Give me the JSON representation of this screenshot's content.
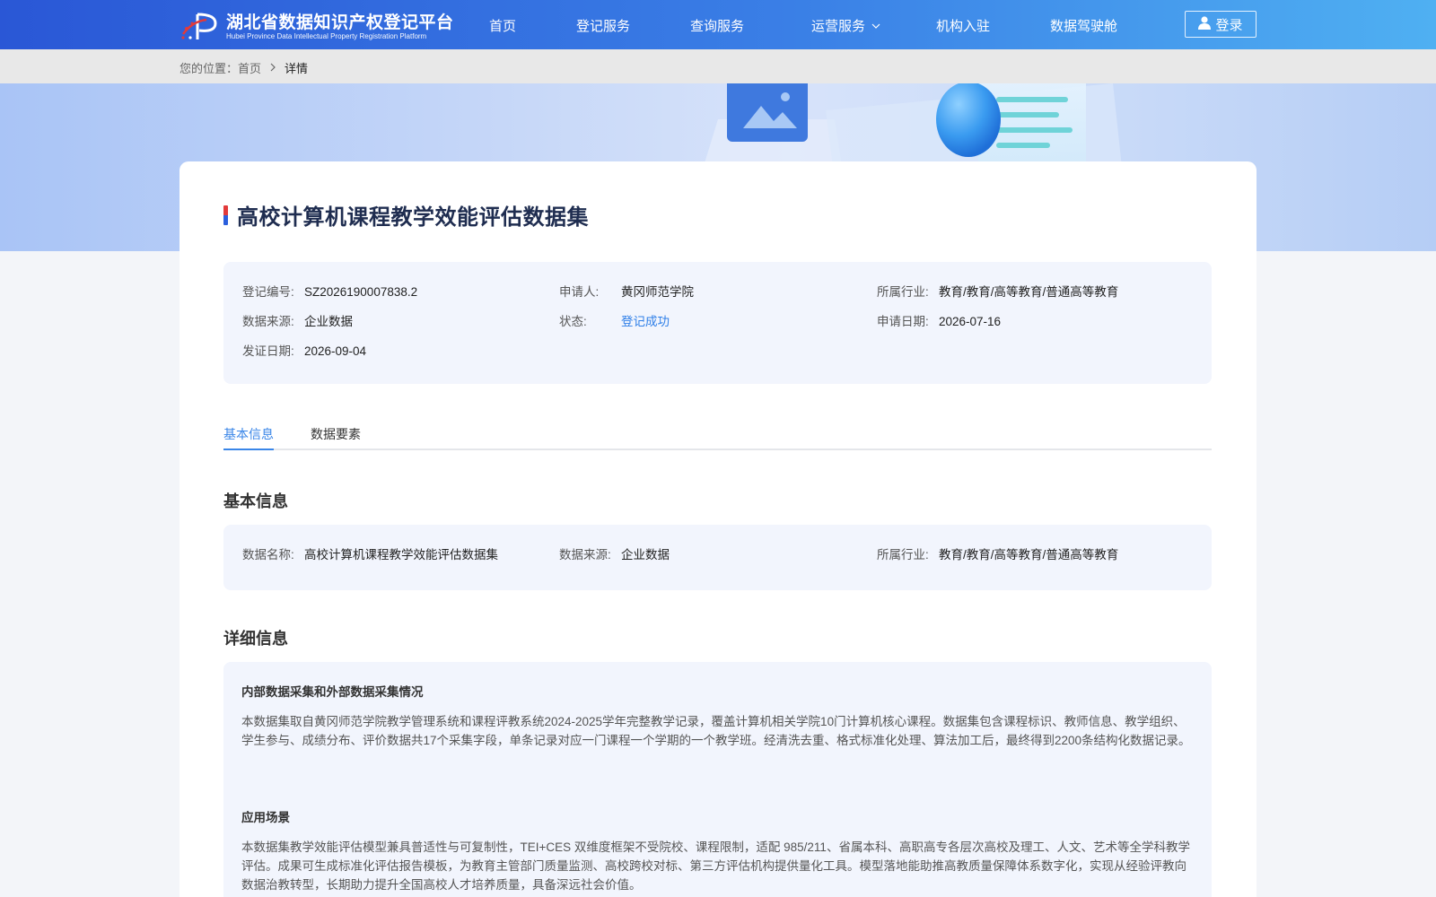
{
  "header": {
    "logo_cn": "湖北省数据知识产权登记平台",
    "logo_en": "Hubei Province Data Intellectual Property Registration Platform",
    "nav": [
      "首页",
      "登记服务",
      "查询服务",
      "运营服务",
      "机构入驻",
      "数据驾驶舱"
    ],
    "login_label": "登录"
  },
  "breadcrumb": {
    "prefix": "您的位置：",
    "home": "首页",
    "current": "详情"
  },
  "detail": {
    "title": "高校计算机课程教学效能评估数据集",
    "summary": {
      "reg_no_label": "登记编号:",
      "reg_no": "SZ2026190007838.2",
      "applicant_label": "申请人:",
      "applicant": "黄冈师范学院",
      "industry_label": "所属行业:",
      "industry": "教育/教育/高等教育/普通高等教育",
      "source_label": "数据来源:",
      "source": "企业数据",
      "status_label": "状态:",
      "status": "登记成功",
      "apply_date_label": "申请日期:",
      "apply_date": "2026-07-16",
      "issue_date_label": "发证日期:",
      "issue_date": "2026-09-04"
    },
    "tabs": [
      "基本信息",
      "数据要素"
    ],
    "basic": {
      "section_title": "基本信息",
      "name_label": "数据名称:",
      "name": "高校计算机课程教学效能评估数据集",
      "source_label": "数据来源:",
      "source": "企业数据",
      "industry_label": "所属行业:",
      "industry": "教育/教育/高等教育/普通高等教育"
    },
    "details": {
      "section_title": "详细信息",
      "collection_title": "内部数据采集和外部数据采集情况",
      "collection_text": "本数据集取自黄冈师范学院教学管理系统和课程评教系统2024-2025学年完整教学记录，覆盖计算机相关学院10门计算机核心课程。数据集包含课程标识、教师信息、教学组织、学生参与、成绩分布、评价数据共17个采集字段，单条记录对应一门课程一个学期的一个教学班。经清洗去重、格式标准化处理、算法加工后，最终得到2200条结构化数据记录。",
      "scenario_title": "应用场景",
      "scenario_text": "本数据集教学效能评估模型兼具普适性与可复制性，TEI+CES 双维度框架不受院校、课程限制，适配 985/211、省属本科、高职高专各层次高校及理工、人文、艺术等全学科教学评估。成果可生成标准化评估报告模板，为教育主管部门质量监测、高校跨校对标、第三方评估机构提供量化工具。模型落地能助推高教质量保障体系数字化，实现从经验评教向数据治教转型，长期助力提升全国高校人才培养质量，具备深远社会价值。"
    }
  },
  "colors": {
    "header_start": "#2a57d6",
    "header_end": "#4fb0f2",
    "accent": "#3a86e8",
    "title": "#1f2d50",
    "box_bg": "#f2f5fd"
  }
}
